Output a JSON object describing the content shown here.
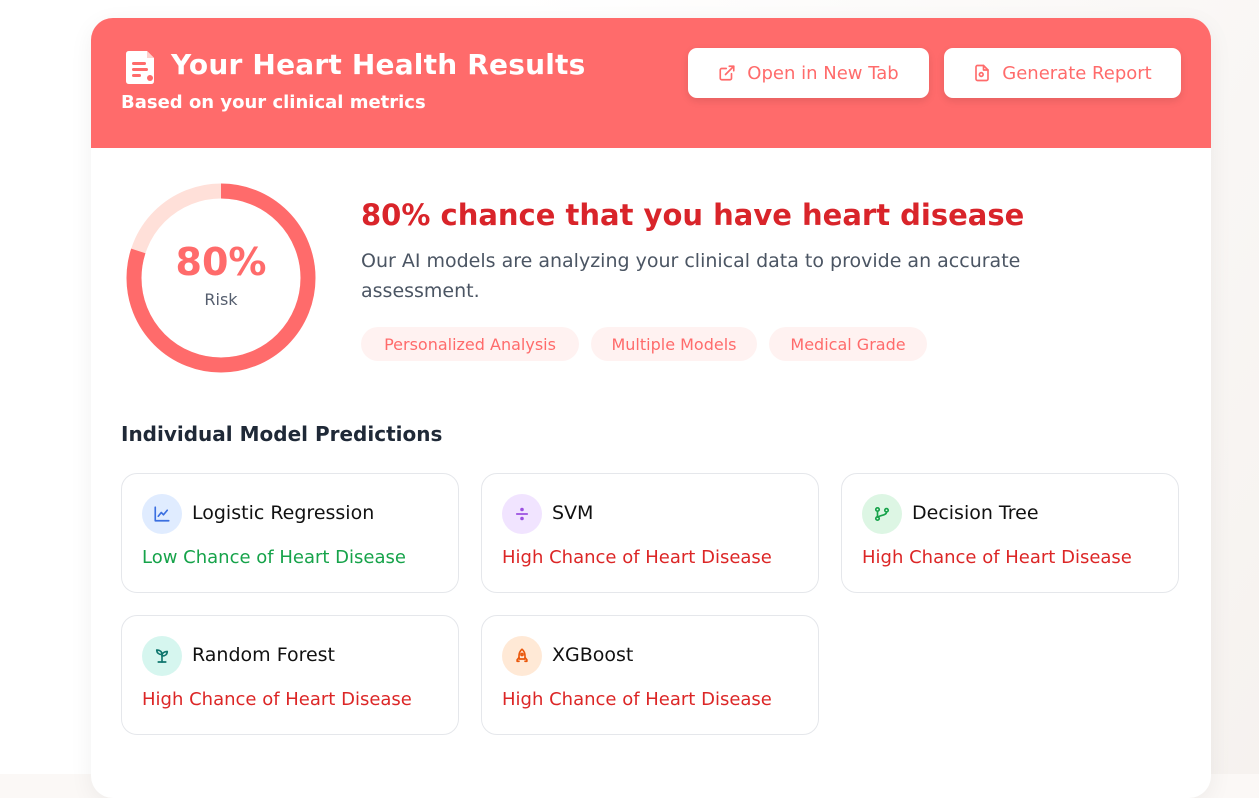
{
  "header": {
    "title": "Your Heart Health Results",
    "subtitle": "Based on your clinical metrics",
    "icon": "report-icon",
    "open_button_label": "Open in New Tab",
    "open_button_icon": "external-link-icon",
    "report_button_label": "Generate Report",
    "report_button_icon": "document-icon"
  },
  "risk": {
    "value": 80,
    "value_text": "80%",
    "label": "Risk",
    "headline": "80% chance that you have heart disease",
    "description": "Our AI models are analyzing your clinical data to provide an accurate assessment.",
    "tags": [
      "Personalized Analysis",
      "Multiple Models",
      "Medical Grade"
    ]
  },
  "predictions": {
    "title": "Individual Model Predictions",
    "models": [
      {
        "name": "Logistic Regression",
        "result": "Low Chance of Heart Disease",
        "icon": "line-chart-icon",
        "status": "low"
      },
      {
        "name": "SVM",
        "result": "High Chance of Heart Disease",
        "icon": "divide-icon",
        "status": "high"
      },
      {
        "name": "Decision Tree",
        "result": "High Chance of Heart Disease",
        "icon": "git-branch-icon",
        "status": "high"
      },
      {
        "name": "Random Forest",
        "result": "High Chance of Heart Disease",
        "icon": "sprout-icon",
        "status": "high"
      },
      {
        "name": "XGBoost",
        "result": "High Chance of Heart Disease",
        "icon": "rocket-icon",
        "status": "high"
      }
    ]
  },
  "colors": {
    "brand": "#ff6b6b",
    "danger_text": "#d9242a",
    "low_result": "#16a34a",
    "high_result": "#dc2626",
    "gauge_track": "#ffe0d9"
  }
}
